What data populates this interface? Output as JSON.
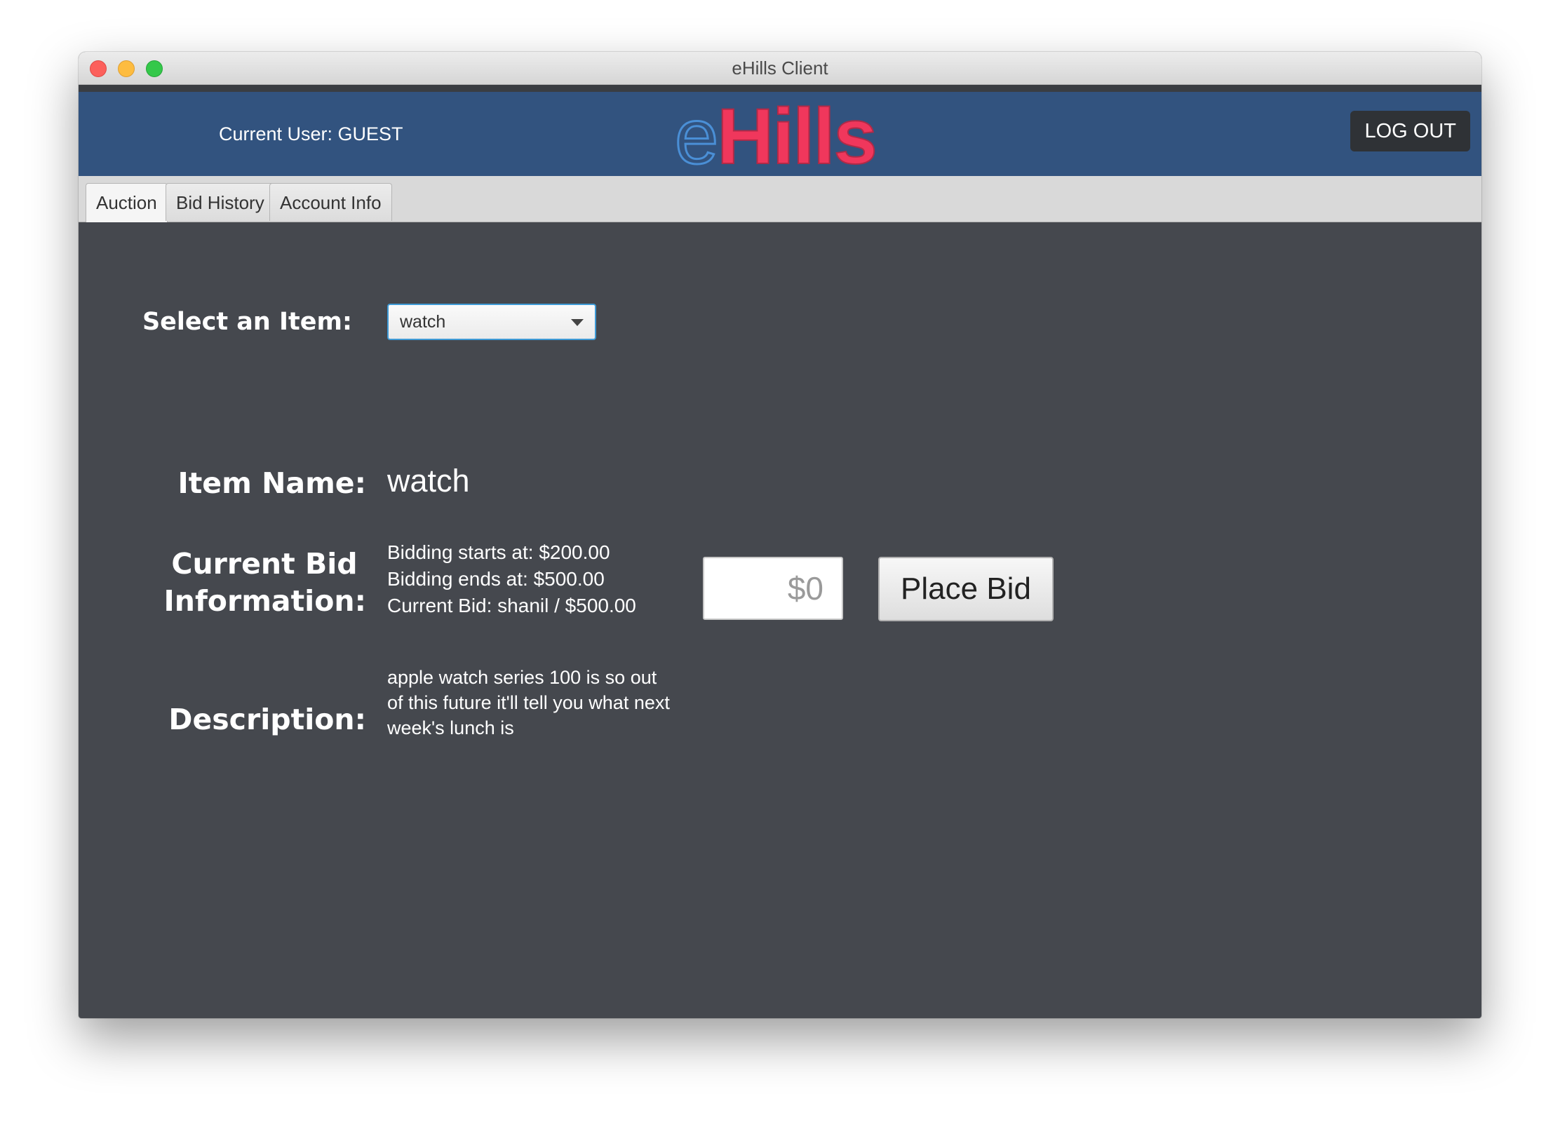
{
  "window": {
    "title": "eHills Client"
  },
  "header": {
    "current_user": "Current User: GUEST",
    "logo_e": "e",
    "logo_rest": "Hills",
    "logout_label": "LOG OUT"
  },
  "tabs": [
    {
      "label": "Auction",
      "active": true
    },
    {
      "label": "Bid History",
      "active": false
    },
    {
      "label": "Account Info",
      "active": false
    }
  ],
  "auction": {
    "select_label": "Select an Item:",
    "selected_item": "watch",
    "item_name_label": "Item Name:",
    "item_name": "watch",
    "bid_info_label_line1": "Current Bid",
    "bid_info_label_line2": "Information:",
    "bidding_starts": "Bidding starts at: $200.00",
    "bidding_ends": "Bidding ends at: $500.00",
    "current_bid": "Current Bid: shanil / $500.00",
    "bid_placeholder": "$0",
    "place_bid_label": "Place Bid",
    "description_label": "Description:",
    "description_line1": "apple watch series 100 is so out",
    "description_line2": "of this future it'll tell you what next",
    "description_line3": "week's lunch is"
  },
  "colors": {
    "header_bg": "#32537f",
    "content_bg": "#45484e",
    "logo_pink": "#f0375c",
    "logo_blue": "#4a8fd6",
    "focus_blue": "#3e9ad6"
  }
}
